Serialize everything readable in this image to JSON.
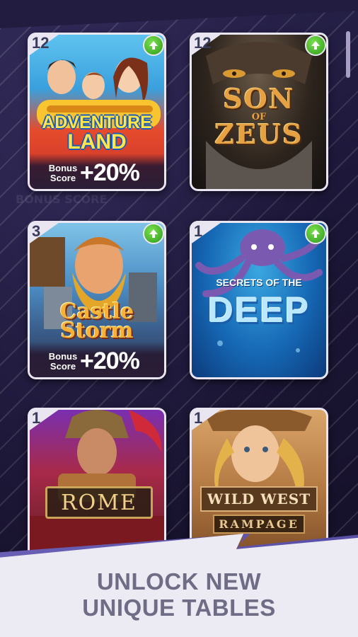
{
  "cards": [
    {
      "id": "adventure-land",
      "level": "12",
      "has_upgrade": true,
      "title_line1": "ADVENTURE",
      "title_line2": "LAND",
      "bonus_label": "Bonus Score",
      "bonus_value": "+20%"
    },
    {
      "id": "son-of-zeus",
      "level": "12",
      "has_upgrade": true,
      "title_line1": "SON",
      "title_line2": "OF",
      "title_line3": "ZEUS"
    },
    {
      "id": "castle-storm",
      "level": "3",
      "has_upgrade": true,
      "title_line1": "Castle",
      "title_line2": "Storm",
      "bonus_label": "Bonus Score",
      "bonus_value": "+20%"
    },
    {
      "id": "secrets-of-the-deep",
      "level": "1",
      "has_upgrade": true,
      "title_line1": "SECRETS OF THE",
      "title_line2": "DEEP"
    },
    {
      "id": "rome",
      "level": "1",
      "has_upgrade": false,
      "title_line1": "ROME"
    },
    {
      "id": "wild-west-rampage",
      "level": "1",
      "has_upgrade": false,
      "title_line1": "WILD WEST",
      "title_line2": "RAMPAGE"
    }
  ],
  "tagline": {
    "line1": "UNLOCK NEW",
    "line2": "UNIQUE TABLES"
  },
  "colors": {
    "upgrade_green": "#3fb82a",
    "card_frame": "#e9e6f2",
    "tagline": "#6f6c86",
    "background": "#1b1636"
  },
  "icons": {
    "upgrade": "arrow-up-icon"
  }
}
